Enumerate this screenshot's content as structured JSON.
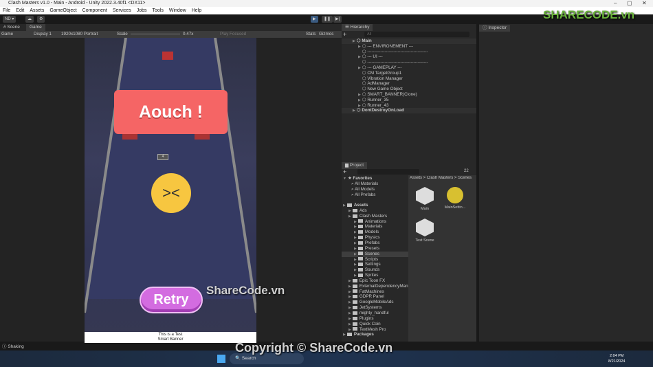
{
  "window": {
    "title": "Clash Masters v1.0 - Main - Android - Unity 2022.3.40f1 <DX11>",
    "min": "–",
    "max": "▢",
    "close": "✕"
  },
  "menu": [
    "File",
    "Edit",
    "Assets",
    "GameObject",
    "Component",
    "Services",
    "Jobs",
    "Tools",
    "Window",
    "Help"
  ],
  "toolbar": {
    "account": "ND ▾",
    "play": "▶",
    "pause": "❚❚",
    "step": "▶|"
  },
  "game_tabs": {
    "scene": "# Scene",
    "game": "Game"
  },
  "game_toolbar": {
    "mode": "Game",
    "display": "Display 1",
    "resolution": "1920x1080 Portrait",
    "scale_label": "Scale",
    "scale_value": "0.47x",
    "play_focused": "Play Focused",
    "stats": "Stats",
    "gizmos": "Gizmos"
  },
  "game": {
    "aouch": "Aouch !",
    "retry": "Retry",
    "counter": "4",
    "banner_line1": "This is a Test",
    "banner_line2": "Smart Banner"
  },
  "hierarchy": {
    "title": "Hierarchy",
    "search_placeholder": "All",
    "items": [
      {
        "label": "Main",
        "depth": 0,
        "expand": true
      },
      {
        "label": "--- ENVIRONEMENT ---",
        "depth": 1,
        "expand": true
      },
      {
        "label": "------------------------------------------",
        "depth": 1,
        "expand": false
      },
      {
        "label": "--- UI ---",
        "depth": 1,
        "expand": true
      },
      {
        "label": "------------------------------------------",
        "depth": 1,
        "expand": false
      },
      {
        "label": "--- GAMEPLAY ---",
        "depth": 1,
        "expand": true
      },
      {
        "label": "CM TargetGroup1",
        "depth": 1,
        "expand": false
      },
      {
        "label": "Vibration Manager",
        "depth": 1,
        "expand": false
      },
      {
        "label": "AdManager",
        "depth": 1,
        "expand": false
      },
      {
        "label": "New Game Object",
        "depth": 1,
        "expand": false
      },
      {
        "label": "SMART_BANNER(Clone)",
        "depth": 1,
        "expand": true
      },
      {
        "label": "Runner_35",
        "depth": 1,
        "expand": true
      },
      {
        "label": "Runner_43",
        "depth": 1,
        "expand": true
      },
      {
        "label": "DontDestroyOnLoad",
        "depth": 0,
        "expand": true
      }
    ]
  },
  "project": {
    "title": "Project",
    "count": "22",
    "breadcrumb": "Assets > Clash Masters > Scenes",
    "favorites": {
      "label": "Favorites",
      "items": [
        "All Materials",
        "All Models",
        "All Prefabs"
      ]
    },
    "tree": [
      {
        "label": "Assets",
        "depth": 0
      },
      {
        "label": "Ads",
        "depth": 1
      },
      {
        "label": "Clash Masters",
        "depth": 1
      },
      {
        "label": "Animations",
        "depth": 2
      },
      {
        "label": "Materials",
        "depth": 2
      },
      {
        "label": "Models",
        "depth": 2
      },
      {
        "label": "Physics",
        "depth": 2
      },
      {
        "label": "Prefabs",
        "depth": 2
      },
      {
        "label": "Presets",
        "depth": 2
      },
      {
        "label": "Scenes",
        "depth": 2,
        "selected": true
      },
      {
        "label": "Scripts",
        "depth": 2
      },
      {
        "label": "Settings",
        "depth": 2
      },
      {
        "label": "Sounds",
        "depth": 2
      },
      {
        "label": "Sprites",
        "depth": 2
      },
      {
        "label": "Epic Toon FX",
        "depth": 1
      },
      {
        "label": "ExternalDependencyMana",
        "depth": 1
      },
      {
        "label": "FatMachines",
        "depth": 1
      },
      {
        "label": "GDPR Panel",
        "depth": 1
      },
      {
        "label": "GoogleMobileAds",
        "depth": 1
      },
      {
        "label": "JetSystems",
        "depth": 1
      },
      {
        "label": "mighty_handful",
        "depth": 1
      },
      {
        "label": "Plugins",
        "depth": 1
      },
      {
        "label": "Quick Coin",
        "depth": 1
      },
      {
        "label": "TextMesh Pro",
        "depth": 1
      },
      {
        "label": "Packages",
        "depth": 0
      }
    ],
    "assets": [
      "Main",
      "MainSettin...",
      "Test Scene"
    ]
  },
  "inspector": {
    "title": "Inspector"
  },
  "status": "Shaking",
  "taskbar": {
    "search": "Search",
    "time": "2:04 PM",
    "date": "8/21/2024"
  },
  "watermarks": {
    "logo": "SHARECODE.vn",
    "center": "ShareCode.vn",
    "copyright": "Copyright © ShareCode.vn"
  }
}
